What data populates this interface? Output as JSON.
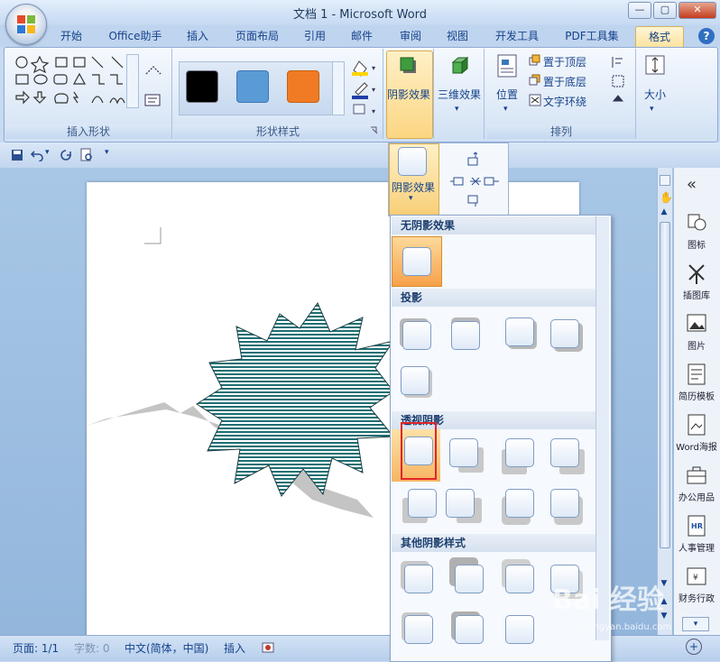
{
  "window": {
    "title": "文档 1 - Microsoft Word",
    "minimize": "—",
    "maximize": "▢",
    "close": "✕"
  },
  "tabs": [
    "开始",
    "Office助手",
    "插入",
    "页面布局",
    "引用",
    "邮件",
    "审阅",
    "视图",
    "开发工具",
    "PDF工具集",
    "格式"
  ],
  "help_icon": "?",
  "ribbon": {
    "insert_shapes_label": "插入形状",
    "shape_styles_label": "形状样式",
    "style_colors": [
      "#000000",
      "#5b9bd5",
      "#f07b24"
    ],
    "shadow_effects": "阴影效果",
    "three_d_effects": "三维效果",
    "position": "位置",
    "bring_to_front": "置于顶层",
    "send_to_back": "置于底层",
    "text_wrap": "文字环绕",
    "arrange_label": "排列",
    "size": "大小"
  },
  "shadow_dropdown": {
    "button_label": "阴影效果"
  },
  "gallery": {
    "no_shadow": "无阴影效果",
    "drop_shadow": "投影",
    "perspective_shadow": "透视阴影",
    "other_shadow": "其他阴影样式"
  },
  "side_panel": [
    {
      "label": "图标",
      "icon": "shape-icon"
    },
    {
      "label": "插图库",
      "icon": "windmill-icon"
    },
    {
      "label": "图片",
      "icon": "picture-icon"
    },
    {
      "label": "简历模板",
      "icon": "resume-icon"
    },
    {
      "label": "Word海报",
      "icon": "poster-icon"
    },
    {
      "label": "办公用品",
      "icon": "briefcase-icon"
    },
    {
      "label": "人事管理",
      "icon": "hr-icon"
    },
    {
      "label": "财务行政",
      "icon": "finance-icon"
    }
  ],
  "statusbar": {
    "page": "页面: 1/1",
    "words": "字数: 0",
    "language": "中文(简体，中国)",
    "insert": "插入"
  },
  "watermark": {
    "brand": "Bai 经验",
    "url": "jingyan.baidu.com"
  },
  "colors": {
    "starburst_fill": "#1f6f73",
    "starburst_stripes": "#ffffff",
    "shadow_gray": "#c4c4c4",
    "highlight_orange": "#f7a14b",
    "selection_red": "#e0262a"
  }
}
